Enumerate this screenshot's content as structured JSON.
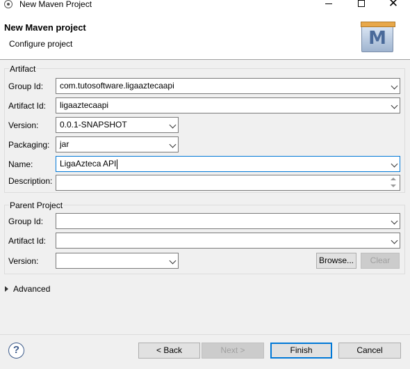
{
  "window": {
    "title": "New Maven Project",
    "icon": "eclipse-icon",
    "controls": {
      "minimize": "minimize-icon",
      "maximize": "maximize-icon",
      "close": "✕"
    }
  },
  "header": {
    "title": "New Maven project",
    "subtitle": "Configure project",
    "logo_letter": "M"
  },
  "artifact": {
    "legend": "Artifact",
    "group_id": {
      "label": "Group Id:",
      "value": "com.tutosoftware.ligaaztecaapi"
    },
    "artifact_id": {
      "label": "Artifact Id:",
      "value": "ligaaztecaapi"
    },
    "version": {
      "label": "Version:",
      "value": "0.0.1-SNAPSHOT"
    },
    "packaging": {
      "label": "Packaging:",
      "value": "jar"
    },
    "name": {
      "label": "Name:",
      "value": "LigaAzteca API"
    },
    "description": {
      "label": "Description:",
      "value": ""
    }
  },
  "parent": {
    "legend": "Parent Project",
    "group_id": {
      "label": "Group Id:",
      "value": ""
    },
    "artifact_id": {
      "label": "Artifact Id:",
      "value": ""
    },
    "version": {
      "label": "Version:",
      "value": ""
    },
    "browse_label": "Browse...",
    "clear_label": "Clear"
  },
  "advanced": {
    "label": "Advanced"
  },
  "footer": {
    "help": "?",
    "back_label": "< Back",
    "next_label": "Next >",
    "finish_label": "Finish",
    "cancel_label": "Cancel"
  },
  "colors": {
    "focus": "#0078d7",
    "background": "#f0f0f0"
  }
}
